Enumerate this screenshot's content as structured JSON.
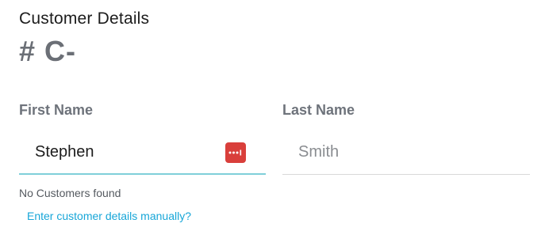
{
  "customer_details": {
    "title": "Customer Details",
    "number": "# C-"
  },
  "form": {
    "first_name": {
      "label": "First Name",
      "value": "Stephen",
      "autofill_icon": "password-manager-icon"
    },
    "last_name": {
      "label": "Last Name",
      "value": "",
      "placeholder": "Smith"
    }
  },
  "status": {
    "message": "No Customers found",
    "manual_link": "Enter customer details manually?"
  },
  "colors": {
    "active_underline": "#7fcfd9",
    "link": "#17a6d8",
    "autofill_icon_bg": "#d93f3b"
  }
}
